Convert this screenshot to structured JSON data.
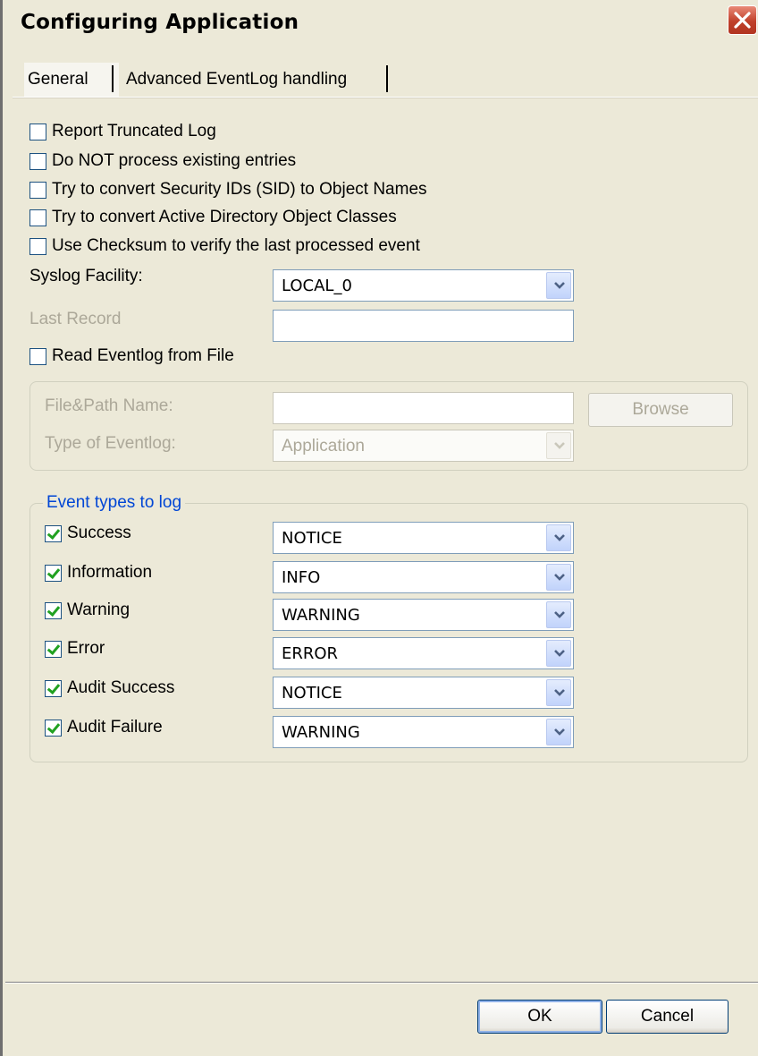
{
  "window": {
    "title": "Configuring Application"
  },
  "tabs": [
    {
      "label": "General",
      "active": true
    },
    {
      "label": "Advanced EventLog handling",
      "active": false
    }
  ],
  "options": [
    {
      "label": "Report Truncated Log",
      "checked": false
    },
    {
      "label": "Do NOT process existing entries",
      "checked": false
    },
    {
      "label": "Try to convert Security IDs (SID) to Object Names",
      "checked": false
    },
    {
      "label": "Try to convert Active Directory Object Classes",
      "checked": false
    },
    {
      "label": "Use Checksum to verify the last processed event",
      "checked": false
    }
  ],
  "syslog_facility": {
    "label": "Syslog Facility:",
    "value": "LOCAL_0"
  },
  "last_record": {
    "label": "Last Record",
    "value": ""
  },
  "read_from_file": {
    "label": "Read Eventlog from File",
    "checked": false
  },
  "file_group": {
    "path_label": "File&Path Name:",
    "path_value": "",
    "browse_label": "Browse",
    "type_label": "Type of Eventlog:",
    "type_value": "Application"
  },
  "event_group": {
    "title": "Event types to log",
    "rows": [
      {
        "label": "Success",
        "checked": true,
        "value": "NOTICE"
      },
      {
        "label": "Information",
        "checked": true,
        "value": "INFO"
      },
      {
        "label": "Warning",
        "checked": true,
        "value": "WARNING"
      },
      {
        "label": "Error",
        "checked": true,
        "value": "ERROR"
      },
      {
        "label": "Audit Success",
        "checked": true,
        "value": "NOTICE"
      },
      {
        "label": "Audit Failure",
        "checked": true,
        "value": "WARNING"
      }
    ]
  },
  "buttons": {
    "ok": "OK",
    "cancel": "Cancel"
  },
  "colors": {
    "accent": "#0046d5",
    "close": "#c0402a",
    "disabled_text": "#aca899",
    "check": "#21a121"
  }
}
